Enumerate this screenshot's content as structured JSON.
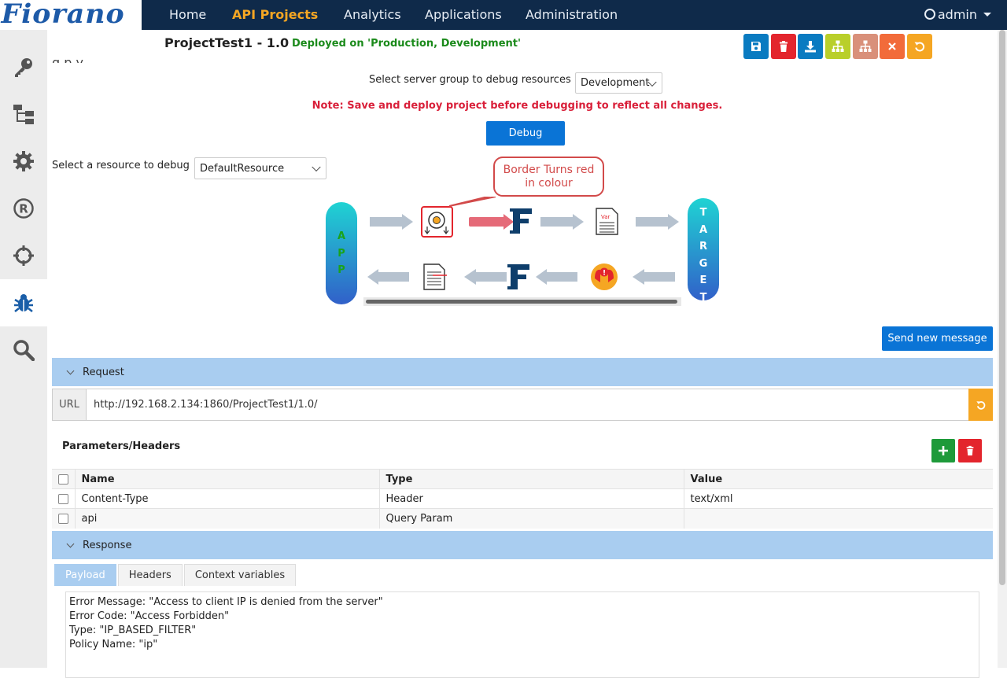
{
  "brand": {
    "logo_text": "Fiorano"
  },
  "nav": {
    "items": [
      "Home",
      "API Projects",
      "Analytics",
      "Applications",
      "Administration"
    ],
    "user": "admin"
  },
  "sidebar": {
    "icons": [
      "key-icon",
      "hierarchy-icon",
      "gear-icon",
      "registered-icon",
      "crosshair-icon",
      "bug-icon",
      "search-icon"
    ]
  },
  "header": {
    "project_title": "ProjectTest1 - 1.0",
    "deploy_status": "Deployed on 'Production, Development'",
    "obscured_title": "g  p  y"
  },
  "debug": {
    "server_group_label": "Select server group to debug resources",
    "server_group_value": "Development",
    "note": "Note: Save and deploy project before debugging to reflect all changes.",
    "debug_button": "Debug",
    "resource_label": "Select a resource to debug",
    "resource_value": "DefaultResource",
    "callout": "Border Turns red in colour",
    "app_pill": [
      "A",
      "P",
      "P"
    ],
    "target_pill": [
      "T",
      "A",
      "R",
      "G",
      "E",
      "T"
    ],
    "accent_color": "#d24a4a"
  },
  "send_button": "Send new message",
  "request": {
    "title": "Request",
    "url_label": "URL",
    "url_value": "http://192.168.2.134:1860/ProjectTest1/1.0/",
    "params_title": "Parameters/Headers",
    "columns": [
      "Name",
      "Type",
      "Value"
    ],
    "rows": [
      {
        "name": "Content-Type",
        "type": "Header",
        "value": "text/xml"
      },
      {
        "name": "api",
        "type": "Query Param",
        "value": ""
      }
    ]
  },
  "response": {
    "title": "Response",
    "tabs": [
      "Payload",
      "Headers",
      "Context variables"
    ],
    "payload_lines": [
      "Error Message: \"Access to client IP is denied from the server\"",
      "Error Code: \"Access Forbidden\"",
      "Type: \"IP_BASED_FILTER\"",
      "Policy Name: \"ip\""
    ]
  }
}
